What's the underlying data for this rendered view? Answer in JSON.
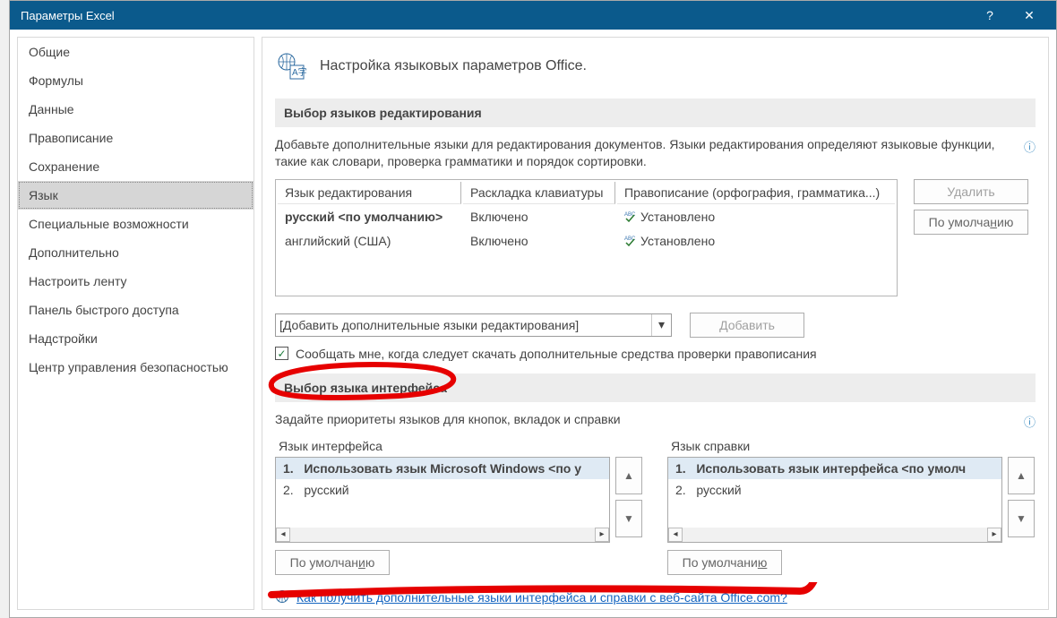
{
  "window": {
    "title": "Параметры Excel",
    "help": "?",
    "close": "✕"
  },
  "sidebar": {
    "items": [
      "Общие",
      "Формулы",
      "Данные",
      "Правописание",
      "Сохранение",
      "Язык",
      "Специальные возможности",
      "Дополнительно",
      "Настроить ленту",
      "Панель быстрого доступа",
      "Надстройки",
      "Центр управления безопасностью"
    ],
    "selectedIndex": 5
  },
  "page": {
    "heading": "Настройка языковых параметров Office.",
    "sectionEdit": {
      "title": "Выбор языков редактирования",
      "description": "Добавьте дополнительные языки для редактирования документов. Языки редактирования определяют языковые функции, такие как словари, проверка грамматики и порядок сортировки.",
      "columns": {
        "lang": "Язык редактирования",
        "layout": "Раскладка клавиатуры",
        "proof": "Правописание (орфография, грамматика...)"
      },
      "rows": [
        {
          "lang": "русский <по умолчанию>",
          "layout": "Включено",
          "proof": "Установлено",
          "bold": true
        },
        {
          "lang": "английский (США)",
          "layout": "Включено",
          "proof": "Установлено",
          "bold": false
        }
      ],
      "btnDelete": "Удалить",
      "btnDefault": "По умолчанию",
      "dropdownText": "[Добавить дополнительные языки редактирования]",
      "btnAdd": "Добавить",
      "checkboxText": "Сообщать мне, когда следует скачать дополнительные средства проверки правописания"
    },
    "sectionUI": {
      "title": "Выбор языка интерфейса",
      "description": "Задайте приоритеты языков для кнопок, вкладок и справки",
      "listInterface": {
        "title": "Язык интерфейса",
        "items": [
          "Использовать язык Microsoft Windows <по у",
          "русский"
        ]
      },
      "listHelp": {
        "title": "Язык справки",
        "items": [
          "Использовать язык интерфейса <по умолч",
          "русский"
        ]
      },
      "btnDefault": "По умолчанию",
      "linkText": "Как получить дополнительные языки интерфейса и справки с веб-сайта Office.com?"
    }
  }
}
